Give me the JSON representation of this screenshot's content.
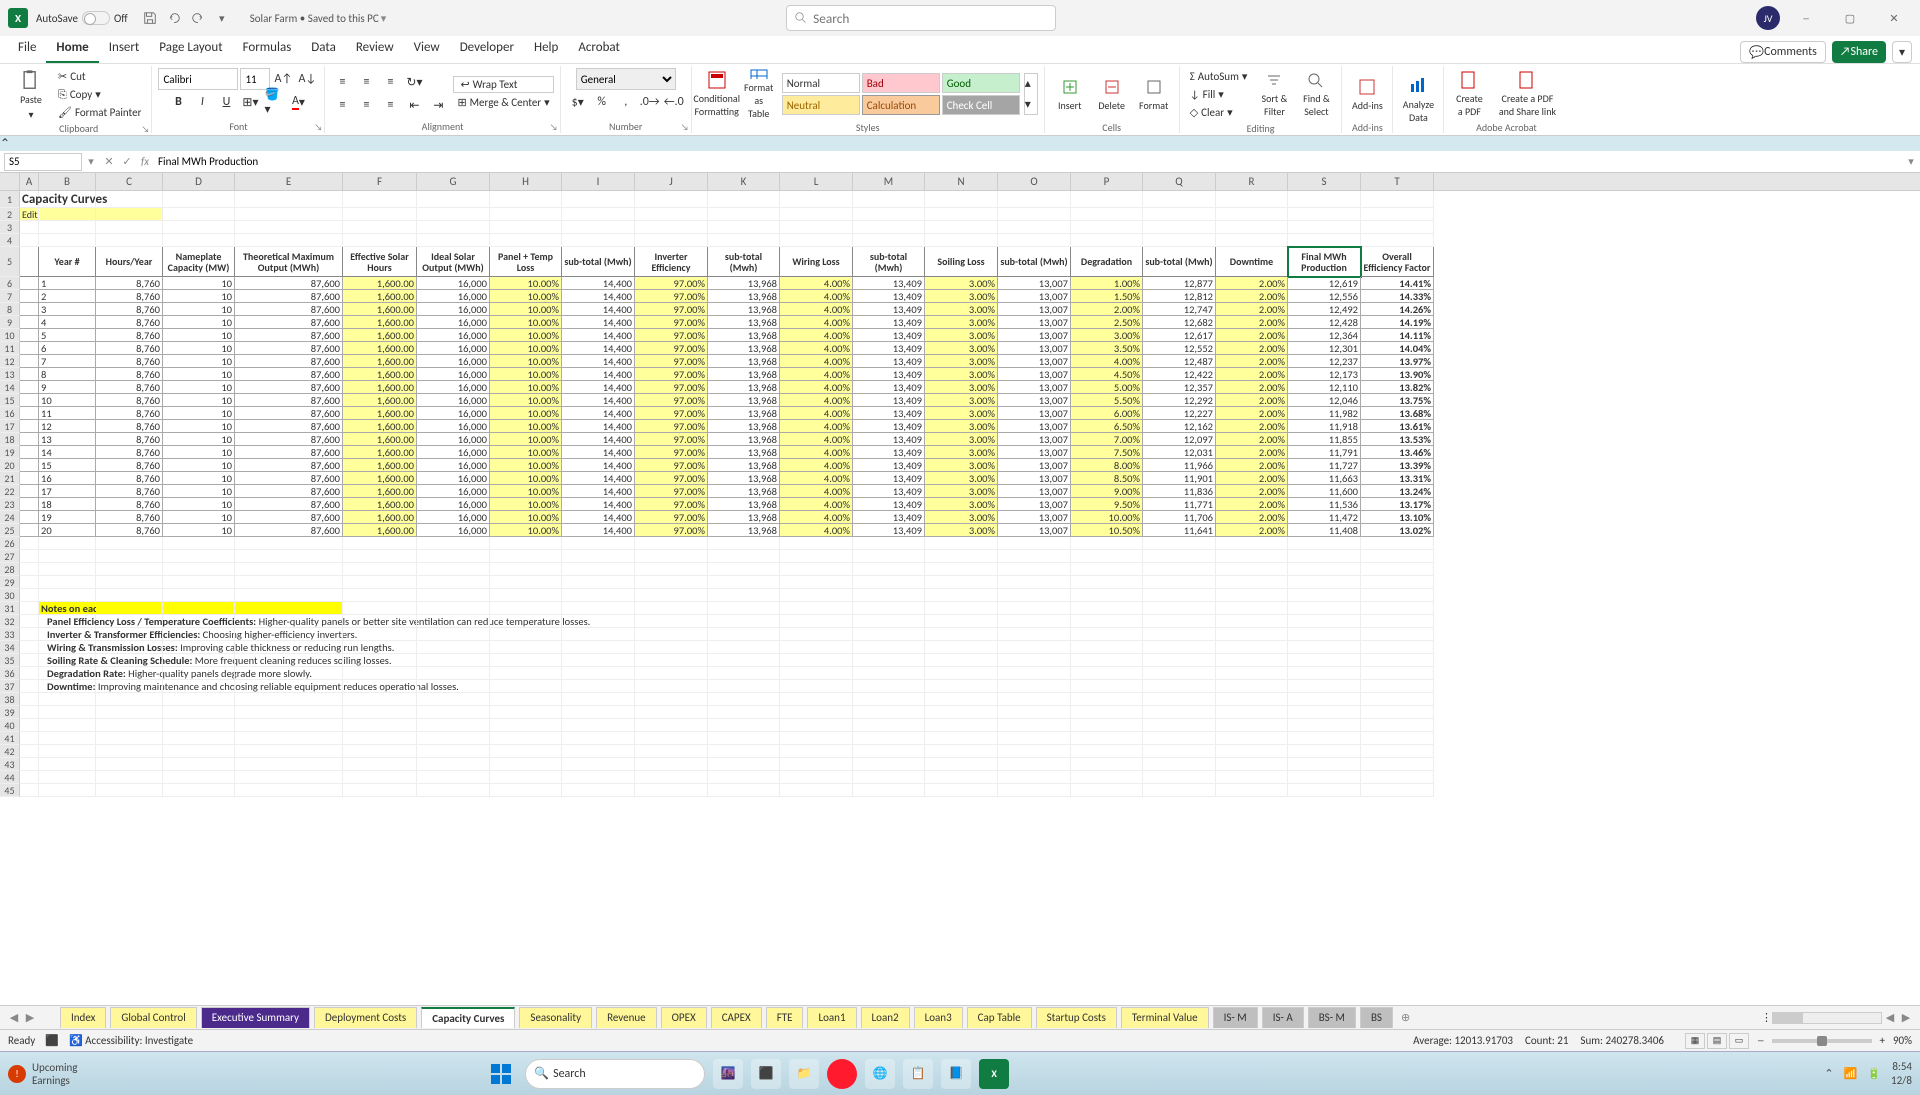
{
  "titlebar": {
    "autosave_label": "AutoSave",
    "autosave_state": "Off",
    "doc_name": "Solar Farm • Saved to this PC ",
    "search_placeholder": "Search",
    "avatar_initials": "JV"
  },
  "menu_tabs": [
    "File",
    "Home",
    "Insert",
    "Page Layout",
    "Formulas",
    "Data",
    "Review",
    "View",
    "Developer",
    "Help",
    "Acrobat"
  ],
  "menu_active": "Home",
  "menu_right": {
    "comments": "Comments",
    "share": "Share"
  },
  "ribbon": {
    "clipboard": {
      "paste": "Paste",
      "cut": "Cut",
      "copy": "Copy",
      "format_painter": "Format Painter",
      "label": "Clipboard"
    },
    "font": {
      "name": "Calibri",
      "size": "11",
      "label": "Font"
    },
    "alignment": {
      "wrap": "Wrap Text",
      "merge": "Merge & Center",
      "label": "Alignment"
    },
    "number": {
      "format": "General",
      "label": "Number"
    },
    "styles": {
      "cond": "Conditional\nFormatting",
      "fmt_table": "Format as\nTable",
      "normal": "Normal",
      "bad": "Bad",
      "good": "Good",
      "neutral": "Neutral",
      "calc": "Calculation",
      "check": "Check Cell",
      "label": "Styles"
    },
    "cells": {
      "insert": "Insert",
      "delete": "Delete",
      "format": "Format",
      "label": "Cells"
    },
    "editing": {
      "autosum": "AutoSum",
      "fill": "Fill",
      "clear": "Clear",
      "sort": "Sort &\nFilter",
      "find": "Find &\nSelect",
      "label": "Editing"
    },
    "addins": {
      "addins": "Add-ins",
      "label": "Add-ins"
    },
    "analyze": {
      "analyze": "Analyze\nData",
      "create_pdf": "Create\na PDF",
      "share_pdf": "Create a PDF\nand Share link",
      "label": "Adobe Acrobat"
    }
  },
  "formulabar": {
    "namebox": "S5",
    "formula": "Final MWh Production"
  },
  "columns": [
    "A",
    "B",
    "C",
    "D",
    "E",
    "F",
    "G",
    "H",
    "I",
    "J",
    "K",
    "L",
    "M",
    "N",
    "O",
    "P",
    "Q",
    "R",
    "S",
    "T"
  ],
  "sheet": {
    "title": "Capacity Curves",
    "edit_note": "Edit cells in this shade only.",
    "headers": [
      "Year #",
      "Hours/Year",
      "Nameplate Capacity (MW)",
      "Theoretical Maximum Output (MWh)",
      "Effective Solar Hours",
      "Ideal Solar Output (MWh)",
      "Panel + Temp Loss",
      "sub-total (Mwh)",
      "Inverter Efficiency",
      "sub-total (Mwh)",
      "Wiring Loss",
      "sub-total (Mwh)",
      "Soiling Loss",
      "sub-total (Mwh)",
      "Degradation",
      "sub-total (Mwh)",
      "Downtime",
      "Final MWh Production",
      "Overall Efficiency Factor"
    ],
    "hl_cols": [
      4,
      6,
      8,
      10,
      12,
      14,
      16
    ],
    "rows": [
      [
        "1",
        "8,760",
        "10",
        "87,600",
        "1,600.00",
        "16,000",
        "10.00%",
        "14,400",
        "97.00%",
        "13,968",
        "4.00%",
        "13,409",
        "3.00%",
        "13,007",
        "1.00%",
        "12,877",
        "2.00%",
        "12,619",
        "14.41%"
      ],
      [
        "2",
        "8,760",
        "10",
        "87,600",
        "1,600.00",
        "16,000",
        "10.00%",
        "14,400",
        "97.00%",
        "13,968",
        "4.00%",
        "13,409",
        "3.00%",
        "13,007",
        "1.50%",
        "12,812",
        "2.00%",
        "12,556",
        "14.33%"
      ],
      [
        "3",
        "8,760",
        "10",
        "87,600",
        "1,600.00",
        "16,000",
        "10.00%",
        "14,400",
        "97.00%",
        "13,968",
        "4.00%",
        "13,409",
        "3.00%",
        "13,007",
        "2.00%",
        "12,747",
        "2.00%",
        "12,492",
        "14.26%"
      ],
      [
        "4",
        "8,760",
        "10",
        "87,600",
        "1,600.00",
        "16,000",
        "10.00%",
        "14,400",
        "97.00%",
        "13,968",
        "4.00%",
        "13,409",
        "3.00%",
        "13,007",
        "2.50%",
        "12,682",
        "2.00%",
        "12,428",
        "14.19%"
      ],
      [
        "5",
        "8,760",
        "10",
        "87,600",
        "1,600.00",
        "16,000",
        "10.00%",
        "14,400",
        "97.00%",
        "13,968",
        "4.00%",
        "13,409",
        "3.00%",
        "13,007",
        "3.00%",
        "12,617",
        "2.00%",
        "12,364",
        "14.11%"
      ],
      [
        "6",
        "8,760",
        "10",
        "87,600",
        "1,600.00",
        "16,000",
        "10.00%",
        "14,400",
        "97.00%",
        "13,968",
        "4.00%",
        "13,409",
        "3.00%",
        "13,007",
        "3.50%",
        "12,552",
        "2.00%",
        "12,301",
        "14.04%"
      ],
      [
        "7",
        "8,760",
        "10",
        "87,600",
        "1,600.00",
        "16,000",
        "10.00%",
        "14,400",
        "97.00%",
        "13,968",
        "4.00%",
        "13,409",
        "3.00%",
        "13,007",
        "4.00%",
        "12,487",
        "2.00%",
        "12,237",
        "13.97%"
      ],
      [
        "8",
        "8,760",
        "10",
        "87,600",
        "1,600.00",
        "16,000",
        "10.00%",
        "14,400",
        "97.00%",
        "13,968",
        "4.00%",
        "13,409",
        "3.00%",
        "13,007",
        "4.50%",
        "12,422",
        "2.00%",
        "12,173",
        "13.90%"
      ],
      [
        "9",
        "8,760",
        "10",
        "87,600",
        "1,600.00",
        "16,000",
        "10.00%",
        "14,400",
        "97.00%",
        "13,968",
        "4.00%",
        "13,409",
        "3.00%",
        "13,007",
        "5.00%",
        "12,357",
        "2.00%",
        "12,110",
        "13.82%"
      ],
      [
        "10",
        "8,760",
        "10",
        "87,600",
        "1,600.00",
        "16,000",
        "10.00%",
        "14,400",
        "97.00%",
        "13,968",
        "4.00%",
        "13,409",
        "3.00%",
        "13,007",
        "5.50%",
        "12,292",
        "2.00%",
        "12,046",
        "13.75%"
      ],
      [
        "11",
        "8,760",
        "10",
        "87,600",
        "1,600.00",
        "16,000",
        "10.00%",
        "14,400",
        "97.00%",
        "13,968",
        "4.00%",
        "13,409",
        "3.00%",
        "13,007",
        "6.00%",
        "12,227",
        "2.00%",
        "11,982",
        "13.68%"
      ],
      [
        "12",
        "8,760",
        "10",
        "87,600",
        "1,600.00",
        "16,000",
        "10.00%",
        "14,400",
        "97.00%",
        "13,968",
        "4.00%",
        "13,409",
        "3.00%",
        "13,007",
        "6.50%",
        "12,162",
        "2.00%",
        "11,918",
        "13.61%"
      ],
      [
        "13",
        "8,760",
        "10",
        "87,600",
        "1,600.00",
        "16,000",
        "10.00%",
        "14,400",
        "97.00%",
        "13,968",
        "4.00%",
        "13,409",
        "3.00%",
        "13,007",
        "7.00%",
        "12,097",
        "2.00%",
        "11,855",
        "13.53%"
      ],
      [
        "14",
        "8,760",
        "10",
        "87,600",
        "1,600.00",
        "16,000",
        "10.00%",
        "14,400",
        "97.00%",
        "13,968",
        "4.00%",
        "13,409",
        "3.00%",
        "13,007",
        "7.50%",
        "12,031",
        "2.00%",
        "11,791",
        "13.46%"
      ],
      [
        "15",
        "8,760",
        "10",
        "87,600",
        "1,600.00",
        "16,000",
        "10.00%",
        "14,400",
        "97.00%",
        "13,968",
        "4.00%",
        "13,409",
        "3.00%",
        "13,007",
        "8.00%",
        "11,966",
        "2.00%",
        "11,727",
        "13.39%"
      ],
      [
        "16",
        "8,760",
        "10",
        "87,600",
        "1,600.00",
        "16,000",
        "10.00%",
        "14,400",
        "97.00%",
        "13,968",
        "4.00%",
        "13,409",
        "3.00%",
        "13,007",
        "8.50%",
        "11,901",
        "2.00%",
        "11,663",
        "13.31%"
      ],
      [
        "17",
        "8,760",
        "10",
        "87,600",
        "1,600.00",
        "16,000",
        "10.00%",
        "14,400",
        "97.00%",
        "13,968",
        "4.00%",
        "13,409",
        "3.00%",
        "13,007",
        "9.00%",
        "11,836",
        "2.00%",
        "11,600",
        "13.24%"
      ],
      [
        "18",
        "8,760",
        "10",
        "87,600",
        "1,600.00",
        "16,000",
        "10.00%",
        "14,400",
        "97.00%",
        "13,968",
        "4.00%",
        "13,409",
        "3.00%",
        "13,007",
        "9.50%",
        "11,771",
        "2.00%",
        "11,536",
        "13.17%"
      ],
      [
        "19",
        "8,760",
        "10",
        "87,600",
        "1,600.00",
        "16,000",
        "10.00%",
        "14,400",
        "97.00%",
        "13,968",
        "4.00%",
        "13,409",
        "3.00%",
        "13,007",
        "10.00%",
        "11,706",
        "2.00%",
        "11,472",
        "13.10%"
      ],
      [
        "20",
        "8,760",
        "10",
        "87,600",
        "1,600.00",
        "16,000",
        "10.00%",
        "14,400",
        "97.00%",
        "13,968",
        "4.00%",
        "13,409",
        "3.00%",
        "13,007",
        "10.50%",
        "11,641",
        "2.00%",
        "11,408",
        "13.02%"
      ]
    ],
    "notes_title": "Notes on each efficiency factor:",
    "notes": [
      {
        "b": "Panel Efficiency Loss / Temperature Coefficients:",
        "t": " Higher-quality panels or better site ventilation can reduce temperature losses."
      },
      {
        "b": "Inverter & Transformer Efficiencies:",
        "t": " Choosing higher-efficiency inverters."
      },
      {
        "b": "Wiring & Transmission Losses:",
        "t": " Improving cable thickness or reducing run lengths."
      },
      {
        "b": "Soiling Rate & Cleaning Schedule:",
        "t": " More frequent cleaning reduces soiling losses."
      },
      {
        "b": "Degradation Rate:",
        "t": " Higher-quality panels degrade more slowly."
      },
      {
        "b": "Downtime:",
        "t": " Improving maintenance and choosing reliable equipment reduces operational losses."
      }
    ]
  },
  "sheet_tabs": [
    {
      "name": "Index",
      "cls": ""
    },
    {
      "name": "Global Control",
      "cls": ""
    },
    {
      "name": "Executive Summary",
      "cls": "purple"
    },
    {
      "name": "Deployment Costs",
      "cls": ""
    },
    {
      "name": "Capacity Curves",
      "cls": "active"
    },
    {
      "name": "Seasonality",
      "cls": ""
    },
    {
      "name": "Revenue",
      "cls": ""
    },
    {
      "name": "OPEX",
      "cls": ""
    },
    {
      "name": "CAPEX",
      "cls": ""
    },
    {
      "name": "FTE",
      "cls": ""
    },
    {
      "name": "Loan1",
      "cls": ""
    },
    {
      "name": "Loan2",
      "cls": ""
    },
    {
      "name": "Loan3",
      "cls": ""
    },
    {
      "name": "Cap Table",
      "cls": ""
    },
    {
      "name": "Startup Costs",
      "cls": ""
    },
    {
      "name": "Terminal Value",
      "cls": ""
    },
    {
      "name": "IS- M",
      "cls": "grey"
    },
    {
      "name": "IS- A",
      "cls": "grey"
    },
    {
      "name": "BS- M",
      "cls": "grey"
    },
    {
      "name": "BS",
      "cls": "grey"
    }
  ],
  "statusbar": {
    "ready": "Ready",
    "accessibility": "Accessibility: Investigate",
    "average": "Average: 12013.91703",
    "count": "Count: 21",
    "sum": "Sum: 240278.3406",
    "zoom": "90%"
  },
  "taskbar": {
    "widget_line1": "Upcoming",
    "widget_line2": "Earnings",
    "search": "Search",
    "time": "8:54",
    "date": "12/8"
  }
}
